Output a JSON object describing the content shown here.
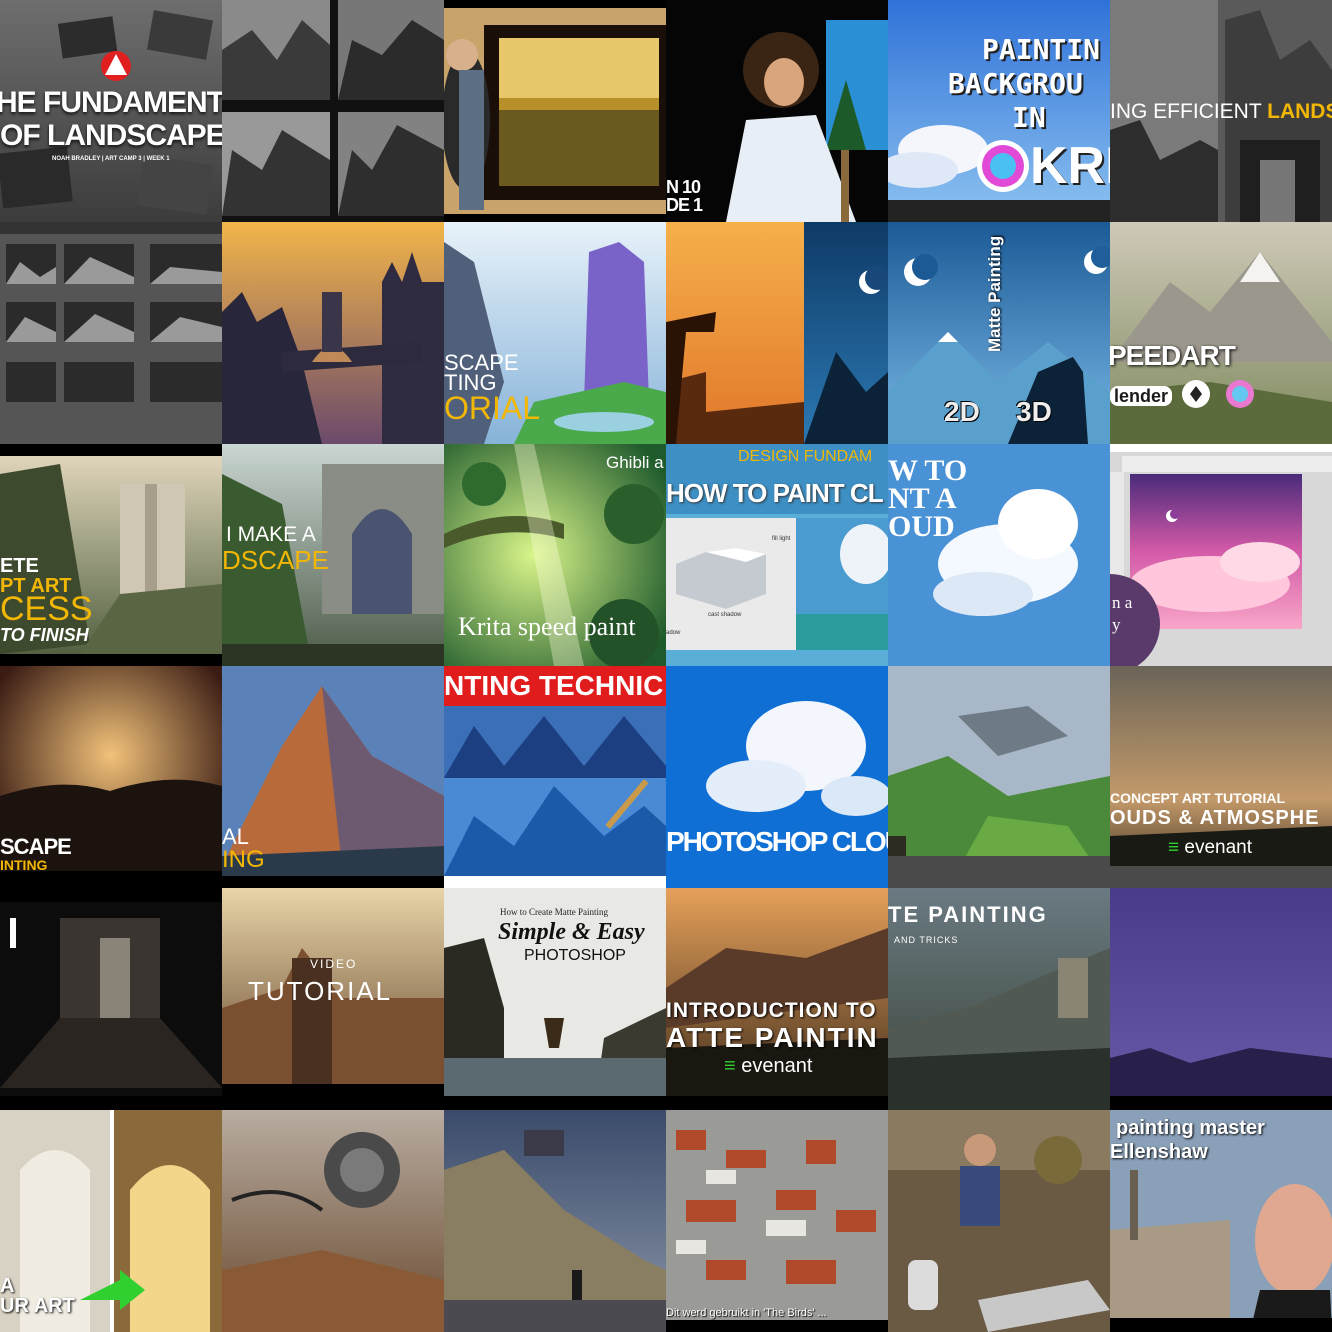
{
  "collage": {
    "tiles": [
      {
        "id": "fundamentals",
        "lines": [
          "HE FUNDAMENTA",
          "OF LANDSCAPES",
          "NOAH BRADLEY | ART CAMP 3 | WEEK 1"
        ]
      },
      {
        "id": "value-thumbs",
        "lines": []
      },
      {
        "id": "framed-painting",
        "lines": []
      },
      {
        "id": "bob-ross",
        "lines": [
          "N 10",
          "DE 1"
        ]
      },
      {
        "id": "krita-background",
        "lines": [
          "PAINTIN",
          "BACKGROU",
          "IN",
          "KRIT"
        ]
      },
      {
        "id": "efficient-landscape",
        "lines": [
          "ING EFFICIENT ",
          "LANDS"
        ]
      },
      {
        "id": "thumb-sheet",
        "lines": []
      },
      {
        "id": "castle-bridge",
        "lines": []
      },
      {
        "id": "landscape-tutorial",
        "lines": [
          "SCAPE",
          "TING",
          "ORIAL"
        ]
      },
      {
        "id": "wolf-sunset",
        "lines": []
      },
      {
        "id": "matte-2d-3d",
        "lines": [
          "Matte Painting",
          "2D",
          "3D"
        ]
      },
      {
        "id": "speedart-blender",
        "lines": [
          "PEEDART",
          "lender"
        ]
      },
      {
        "id": "concept-process",
        "lines": [
          "ETE",
          "PT ART",
          "CESS",
          "TO FINISH"
        ]
      },
      {
        "id": "make-landscape",
        "lines": [
          "I MAKE A",
          "DSCAPE"
        ]
      },
      {
        "id": "krita-ghibli",
        "lines": [
          "Ghibli a",
          "Krita speed paint"
        ]
      },
      {
        "id": "paint-clouds",
        "lines": [
          "DESIGN FUNDAM",
          "HOW TO PAINT CL",
          "fill light",
          "cast shadow",
          "adow"
        ]
      },
      {
        "id": "how-to-cloud",
        "lines": [
          "W TO",
          "NT A",
          "OUD"
        ]
      },
      {
        "id": "pink-clouds",
        "lines": [
          "n a",
          "y"
        ]
      },
      {
        "id": "sunset-landscape",
        "lines": [
          "SCAPE",
          "INTING"
        ]
      },
      {
        "id": "mountain",
        "lines": [
          "AL",
          "ING"
        ]
      },
      {
        "id": "painting-technique",
        "lines": [
          "NTING TECHNIC"
        ]
      },
      {
        "id": "photoshop-cloud",
        "lines": [
          "PHOTOSHOP CLOUD PAI"
        ]
      },
      {
        "id": "green-hills-ship",
        "lines": []
      },
      {
        "id": "clouds-atmosphere",
        "lines": [
          "CONCEPT ART TUTORIAL",
          "OUDS & ATMOSPHE",
          "evenant"
        ]
      },
      {
        "id": "dark-hall",
        "lines": []
      },
      {
        "id": "video-tutorial",
        "lines": [
          "VIDEO",
          "TUTORIAL"
        ]
      },
      {
        "id": "simple-easy",
        "lines": [
          "How to Create Matte Painting",
          "Simple & Easy",
          "PHOTOSHOP"
        ]
      },
      {
        "id": "intro-matte",
        "lines": [
          "INTRODUCTION TO",
          "ATTE PAINTIN",
          "evenant"
        ]
      },
      {
        "id": "matte-tricks",
        "lines": [
          "TE PAINTING",
          "AND TRICKS"
        ]
      },
      {
        "id": "purple-night",
        "lines": []
      },
      {
        "id": "your-art",
        "lines": [
          "A",
          "UR ART"
        ]
      },
      {
        "id": "scifi-desert",
        "lines": []
      },
      {
        "id": "coast-castle",
        "lines": []
      },
      {
        "id": "the-birds",
        "lines": [
          "Dit werd gebruikt in 'The Birds' ..."
        ]
      },
      {
        "id": "lucas-props",
        "lines": []
      },
      {
        "id": "ellenshaw",
        "lines": [
          "painting master",
          "Ellenshaw"
        ]
      }
    ]
  },
  "colors": {
    "yellow": "#f2b705",
    "green": "#2fd02f",
    "red": "#e11c1c"
  }
}
